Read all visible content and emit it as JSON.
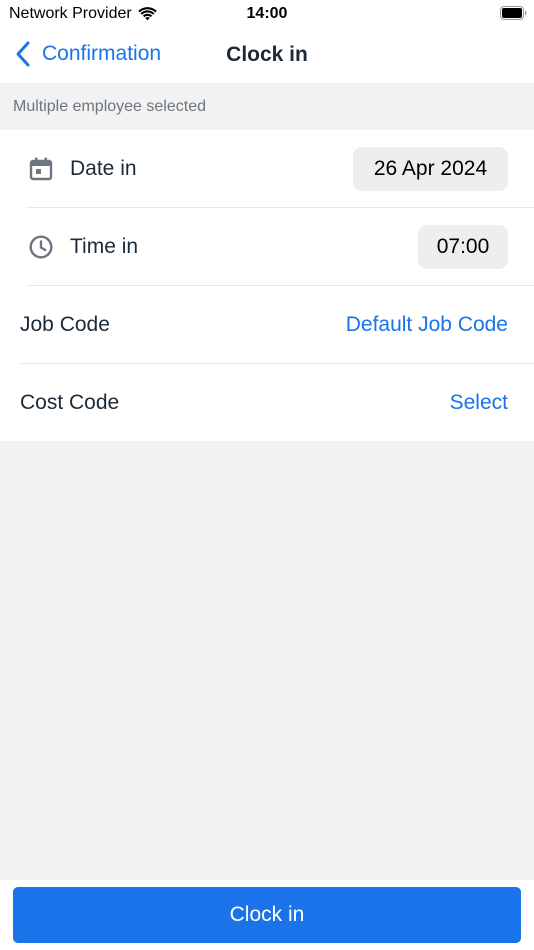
{
  "status_bar": {
    "carrier": "Network Provider",
    "time": "14:00",
    "icons": [
      "wifi-icon",
      "battery-icon"
    ]
  },
  "nav": {
    "back_label": "Confirmation",
    "back_icon": "chevron-left-icon",
    "title": "Clock in"
  },
  "info": {
    "text": "Multiple employee selected"
  },
  "form": {
    "date": {
      "icon": "calendar-icon",
      "label": "Date in",
      "value": "26 Apr 2024"
    },
    "time": {
      "icon": "clock-icon",
      "label": "Time in",
      "value": "07:00"
    },
    "job_code": {
      "label": "Job Code",
      "value": "Default Job Code"
    },
    "cost_code": {
      "label": "Cost Code",
      "value": "Select"
    }
  },
  "footer": {
    "button_label": "Clock in"
  },
  "colors": {
    "accent": "#1a73e8",
    "background": "#f1f2f1",
    "text": "#1c2b3a",
    "muted": "#6d7680",
    "icon": "#6d7680",
    "pill": "#eeeeef"
  }
}
